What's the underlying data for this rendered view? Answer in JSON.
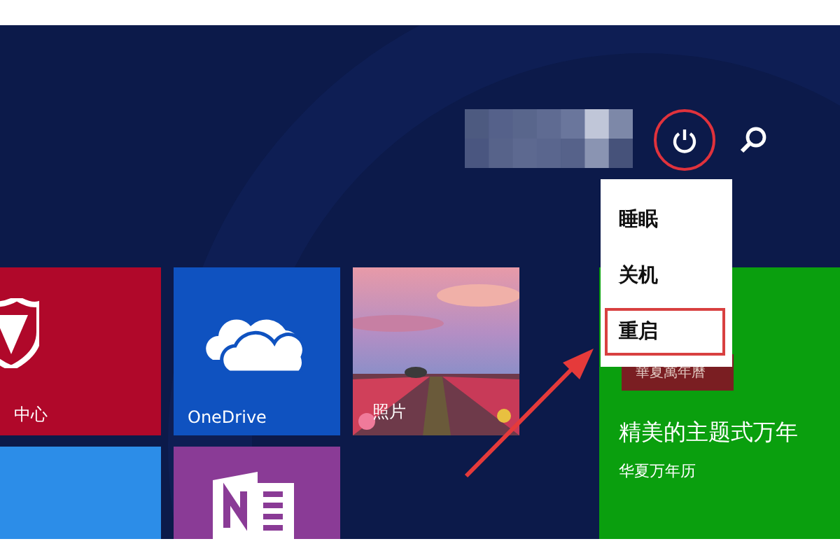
{
  "user": {
    "kind": "pixelated"
  },
  "power_button": {
    "highlighted": true
  },
  "power_menu": [
    {
      "label": "睡眠",
      "highlighted": false
    },
    {
      "label": "关机",
      "highlighted": false
    },
    {
      "label": "重启",
      "highlighted": true
    }
  ],
  "tiles": [
    {
      "kind": "shield",
      "label": "中心",
      "color": "#b0082a"
    },
    {
      "kind": "onedrive",
      "label": "OneDrive",
      "color": "#0f52c0"
    },
    {
      "label": "照片"
    },
    {
      "kind": "blank",
      "color": "#2c8de8"
    },
    {
      "kind": "onenote",
      "color": "#8a3b96"
    },
    {
      "kind": "calendar",
      "banner": "華夏萬年曆",
      "title": "精美的主题式万年",
      "subtitle": "华夏万年历",
      "color": "#0a9f0e"
    }
  ]
}
